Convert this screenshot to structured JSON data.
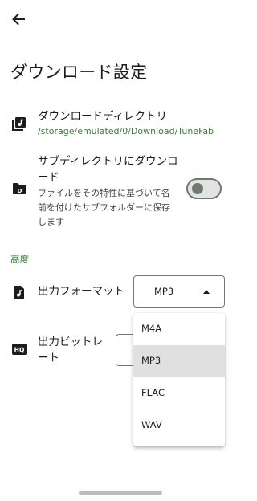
{
  "header": {
    "back_label": "戻る",
    "title": "ダウンロード設定"
  },
  "download_directory": {
    "title": "ダウンロードディレクトリ",
    "path": "/storage/emulated/0/Download/TuneFab",
    "icon": "folder-music-icon"
  },
  "subdirectory": {
    "title_line1": "サブディレクトリにダウンロ",
    "title_line2": "ード",
    "desc_line1": "ファイルをその特性に基づいて名",
    "desc_line2": "前を付けたサブフォルダーに保存",
    "desc_line3": "します",
    "enabled": false,
    "icon": "folder-d-icon"
  },
  "advanced": {
    "section_label": "高度",
    "output_format": {
      "label": "出力フォーマット",
      "value": "MP3",
      "icon": "audio-file-icon"
    },
    "output_bitrate": {
      "label_line1": "出力ビットレ",
      "label_line2": "ート",
      "icon": "hq-icon"
    }
  },
  "format_dropdown": {
    "options": [
      "M4A",
      "MP3",
      "FLAC",
      "WAV"
    ],
    "selected": "MP3"
  },
  "colors": {
    "accent_green": "#3a7d3a",
    "selected_bg": "#e0e0e0",
    "toggle_off": "#6f7970"
  }
}
